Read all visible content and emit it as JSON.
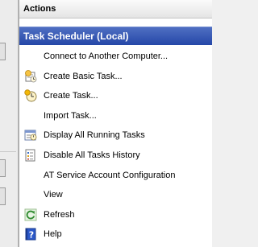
{
  "actions_pane": {
    "header": "Actions",
    "section_title": "Task Scheduler (Local)",
    "items": [
      {
        "label": "Connect to Another Computer...",
        "icon": ""
      },
      {
        "label": "Create Basic Task...",
        "icon": "wizard-icon"
      },
      {
        "label": "Create Task...",
        "icon": "create-task-icon"
      },
      {
        "label": "Import Task...",
        "icon": ""
      },
      {
        "label": "Display All Running Tasks",
        "icon": "running-tasks-icon"
      },
      {
        "label": "Disable All Tasks History",
        "icon": "tasks-history-icon"
      },
      {
        "label": "AT Service Account Configuration",
        "icon": ""
      },
      {
        "label": "View",
        "icon": ""
      },
      {
        "label": "Refresh",
        "icon": "refresh-icon"
      },
      {
        "label": "Help",
        "icon": "help-icon"
      }
    ]
  },
  "colors": {
    "section_header_bg": "#2547a8",
    "section_header_text": "#ffffff"
  }
}
